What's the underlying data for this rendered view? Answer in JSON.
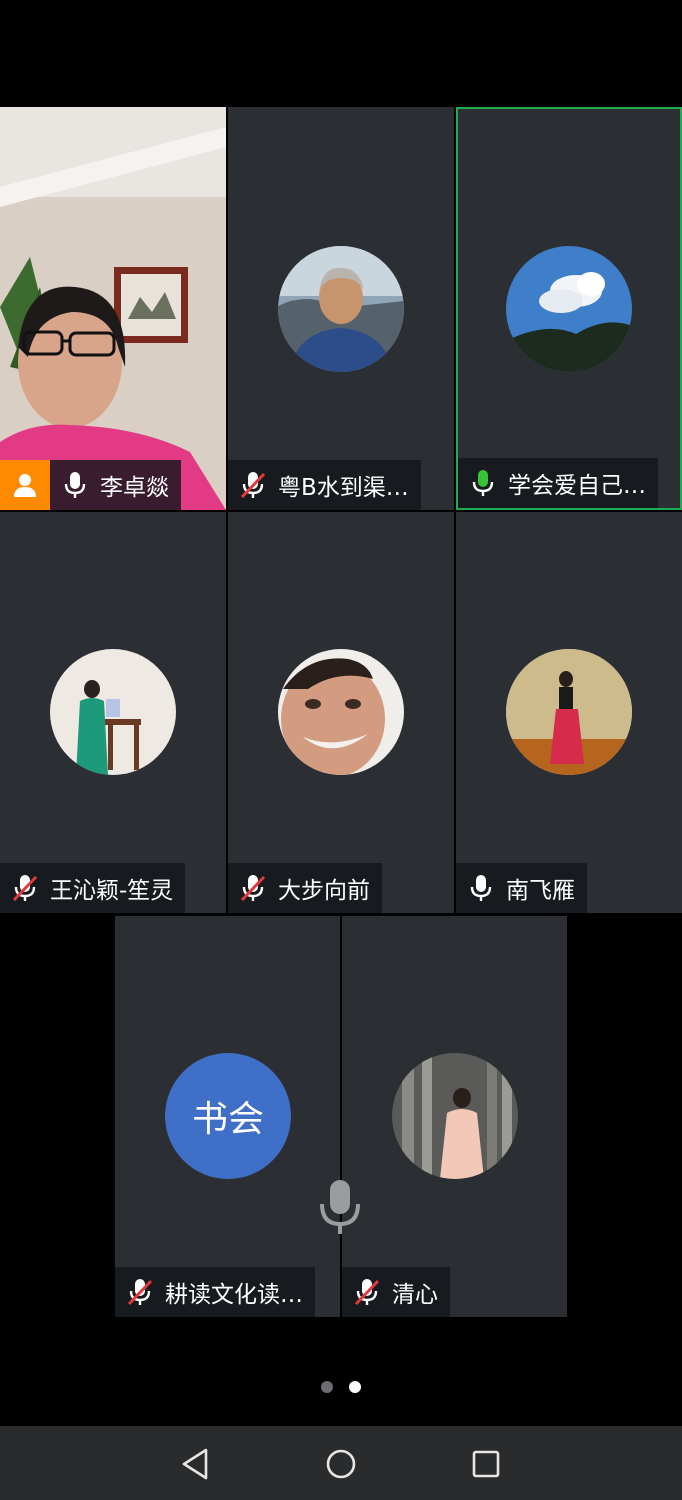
{
  "participants": [
    {
      "name": "李卓燚",
      "mic": "on",
      "video": true
    },
    {
      "name": "粤B水到渠…",
      "mic": "muted"
    },
    {
      "name": "学会爱自己…",
      "mic": "speaking",
      "active": true
    },
    {
      "name": "王沁颖-笙灵",
      "mic": "muted"
    },
    {
      "name": "大步向前",
      "mic": "muted"
    },
    {
      "name": "南飞雁",
      "mic": "on"
    },
    {
      "name": "耕读文化读…",
      "mic": "muted",
      "avatar_text": "书会"
    },
    {
      "name": "清心",
      "mic": "muted"
    }
  ],
  "pager": {
    "pages": 2,
    "current": 2
  },
  "colors": {
    "active_border": "#1fae4e",
    "speaking_mic": "#37c437",
    "avatar_blue": "#3f6fc6",
    "host_badge": "#ff8a00"
  },
  "icons": {
    "host": "person-icon",
    "mic": "microphone-icon",
    "mic_muted": "microphone-muted-icon",
    "back": "back-triangle-icon",
    "home": "home-circle-icon",
    "recents": "recents-square-icon"
  }
}
